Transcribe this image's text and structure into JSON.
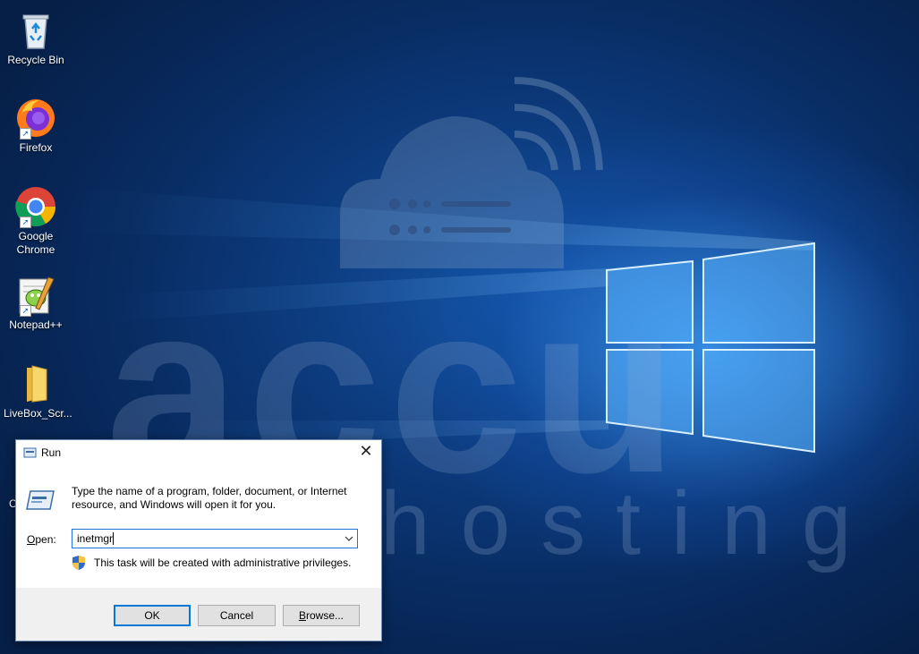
{
  "desktop": {
    "watermark_brand": "accu",
    "watermark_sub": "hosting",
    "icons": [
      {
        "label": "Recycle Bin",
        "icon": "recycle-bin-icon"
      },
      {
        "label": "Firefox",
        "icon": "firefox-icon"
      },
      {
        "label": "Google Chrome",
        "icon": "chrome-icon"
      },
      {
        "label": "Notepad++",
        "icon": "notepad-plus-plus-icon"
      },
      {
        "label": "LiveBox_Scr...",
        "icon": "folder-icon"
      }
    ],
    "partial_label": "C"
  },
  "run_dialog": {
    "title": "Run",
    "close_glyph": "✕",
    "description": "Type the name of a program, folder, document, or Internet resource, and Windows will open it for you.",
    "open_label_prefix": "",
    "open_label_underlined": "O",
    "open_label_rest": "pen:",
    "input_value": "inetmgr",
    "admin_note": "This task will be created with administrative privileges.",
    "buttons": {
      "ok": "OK",
      "cancel": "Cancel",
      "browse_underlined": "B",
      "browse_rest": "rowse..."
    }
  },
  "colors": {
    "accent": "#0078d7",
    "dialog_footer": "#f0f0f0",
    "desktop_bg": "#0a2a5c"
  }
}
